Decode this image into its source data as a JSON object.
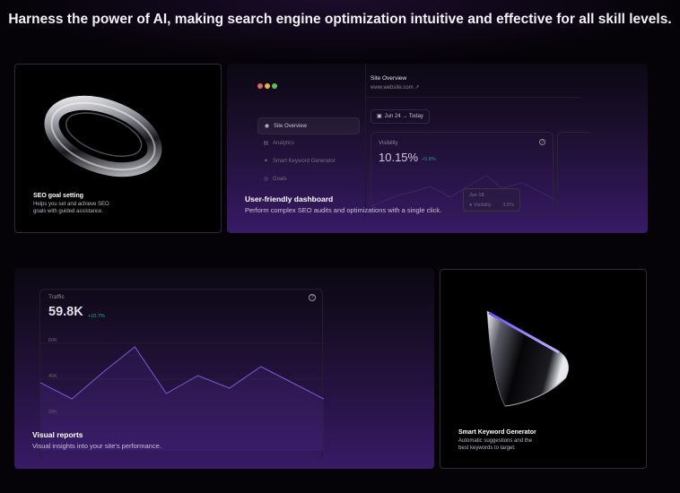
{
  "headline": "Harness the power of AI, making search engine optimization intuitive and effective for all skill levels.",
  "features": {
    "seo_goal": {
      "title": "SEO goal setting",
      "description": "Helps you set and achieve SEO goals with guided assistance.",
      "icon": "torus-ring-icon"
    },
    "dashboard": {
      "title": "User-friendly dashboard",
      "description": "Perform complex SEO audits and optimizations with a single click."
    },
    "reports": {
      "title": "Visual reports",
      "description": "Visual insights into your site's performance."
    },
    "keyword": {
      "title": "Smart Keyword Generator",
      "description": "Automatic suggestions and the best keywords to target.",
      "icon": "cone-icon"
    }
  },
  "dashboard_mock": {
    "window_dots": [
      "#e0655a",
      "#e6b24a",
      "#5fbf5c"
    ],
    "sidebar": [
      {
        "label": "Site Overview",
        "icon": "eye-icon",
        "active": true
      },
      {
        "label": "Analytics",
        "icon": "bar-chart-icon",
        "active": false
      },
      {
        "label": "Smart Keyword Generator",
        "icon": "sparkle-icon",
        "active": false
      },
      {
        "label": "Goals",
        "icon": "target-icon",
        "active": false
      }
    ],
    "title": "Site Overview",
    "url": "www.website.com ↗",
    "date_range": "Jun 24 → Today",
    "visibility": {
      "label": "Visibility",
      "value": "10.15%",
      "delta": "+5.8%",
      "tooltip_date": "Jun 18",
      "tooltip_label": "Visibility",
      "tooltip_value": "3.5%"
    }
  },
  "traffic_mock": {
    "label": "Traffic",
    "value": "59.8K",
    "delta": "+10.7%"
  },
  "chart_data": {
    "type": "line",
    "title": "",
    "xlabel": "",
    "ylabel": "",
    "y_ticks": [
      "60K",
      "40K",
      "20K"
    ],
    "ylim": [
      10000,
      70000
    ],
    "x": [
      0,
      1,
      2,
      3,
      4,
      5,
      6,
      7,
      8,
      9
    ],
    "series": [
      {
        "values": [
          38000,
          29000,
          44000,
          58000,
          32000,
          42000,
          35000,
          47000,
          38000,
          29000
        ]
      }
    ],
    "grid": true,
    "line_color": "#7b5bd6"
  }
}
